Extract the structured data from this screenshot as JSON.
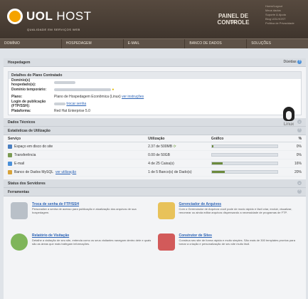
{
  "header": {
    "brand_bold": "UOL",
    "brand_thin": "HOST",
    "brand_sub": "QUALIDADE EM SERVIÇOS WEB",
    "panel_title": "PAINEL DE CONTROLE",
    "panel_sub": "SAV",
    "links": [
      "Home/Logout",
      "Meus dados",
      "Suporte & Ajuda",
      "Blog UOLHOST",
      "Política de Privacidade"
    ]
  },
  "nav": [
    "DOMÍNIO",
    "HOSPEDAGEM",
    "E-MAIL",
    "BANCO DE DADOS",
    "SOLUÇÕES"
  ],
  "section_hosting": {
    "title": "Hospedagem",
    "right": "Dúvidas"
  },
  "plan_box": {
    "title": "Detalhes do Plano Contratado",
    "rows": [
      {
        "k": "Domínio(s) hospedado(s):",
        "v": ""
      },
      {
        "k": "Domínio temporário:",
        "v": ""
      },
      {
        "k": "Plano:",
        "v": "Plano de Hospedagem Econômica (Linux)",
        "link": "ver instruções"
      },
      {
        "k": "Login de publicação (FTP/SSH):",
        "v": "",
        "link": "trocar senha"
      },
      {
        "k": "Plataforma:",
        "v": "Red Hat Enterprise 5.0"
      }
    ],
    "os_label": "Linux"
  },
  "section_tech": "Dados Técnicos",
  "section_stats": "Estatísticas de Utilização",
  "stats": {
    "headers": [
      "Serviço",
      "Utilização",
      "Gráfico",
      "%"
    ],
    "rows": [
      {
        "service": "Espaço em disco do site",
        "usage": "2.37 de 500MB",
        "pct": "0%",
        "fill": 0.02,
        "color": "#4a7fc1"
      },
      {
        "service": "Transferência",
        "usage": "0.00 de 50GB",
        "pct": "0%",
        "fill": 0.0,
        "color": "#7a9a52"
      },
      {
        "service": "E-mail",
        "usage": "4 de 25 Caixa(s)",
        "pct": "16%",
        "fill": 0.16,
        "color": "#4a90d9"
      },
      {
        "service": "Banco de Dados MySQL",
        "link": "ver utilização",
        "usage": "1 de 5 Banco(s) de Dado(s)",
        "pct": "20%",
        "fill": 0.2,
        "color": "#d8a33a"
      }
    ]
  },
  "section_servers": "Status dos Servidores",
  "section_tools": "Ferramentas",
  "tools": [
    {
      "title": "Troca de senha de FTP/SSH",
      "desc": "Personalize a senha de acesso para publicação e atualização dos arquivos de sua hospedagem.",
      "icon": "keys-icon"
    },
    {
      "title": "Gerenciador de Arquivos",
      "desc": "Com o Gerenciador de Arquivos você pode de modo rápido e fácil criar, excluir, visualizar, renomear ou ainda editar arquivos dispensando a necessidade de programas de FTP.",
      "icon": "folder-icon"
    },
    {
      "title": "Relatório de Visitação",
      "desc": "Detalhe a visitação de seu site, entenda como os seus visitantes navegam dentro dele e quais são as áreas que mais trafegam informações.",
      "icon": "chart-icon"
    },
    {
      "title": "Construtor de Sites",
      "desc": "Construa seu site de forma rápida e muito simples. São mais de 300 templates prontos para tornar a criação e personalização de seu site muito fácil.",
      "icon": "builder-icon"
    }
  ]
}
